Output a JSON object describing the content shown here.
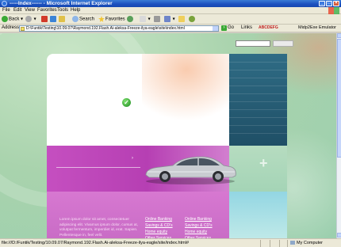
{
  "window": {
    "title": "-----Index------ - Microsoft Internet Explorer",
    "buttons": [
      "_",
      "□",
      "×"
    ]
  },
  "menu": {
    "items": [
      "File",
      "Edit",
      "View",
      "Favorites",
      "Tools",
      "Help"
    ]
  },
  "toolbar": {
    "back_label": "Back",
    "search_label": "Search",
    "favorites_label": "Favorites"
  },
  "address": {
    "label": "Address",
    "value": "D:\\Funtik\\Testing\\10.09.07\\Raymond.192.Flash.Ai-aleksa-Freeze-ilya-eagle\\site\\index.html",
    "go_label": "Go",
    "links_label": "Links",
    "toolbar_brand": "ABCDEFG",
    "emulator_label": "Midp2Exe Emulator"
  },
  "page": {
    "lorem_text": "Lorem ipsum dolor sit amet, consectetuer adipiscing elit. Vivamus ipsum dolor, cursus at, volutpat fermentum, imperdiet id, erat. Sapien. Pellentesque in, feel velit.",
    "links_col1": [
      "Online Banking",
      "Savings & CD's",
      "Home equity",
      "Other Services"
    ],
    "links_col2": [
      "Online Banking",
      "Savings & CD's",
      "Home equity",
      "Other Services"
    ]
  },
  "status": {
    "text": "file:///D:/Funtik/Testing/10.09.07/Raymond.192.Flash.Ai-aleksa-Freeze-ilya-eagle/site/index.html#",
    "zone": "My Computer"
  },
  "colors": {
    "page_bg": "#a9d3ad",
    "magenta": "#b63fb3",
    "teal": "#1f4f66",
    "titlebar": "#1b4fbf"
  }
}
